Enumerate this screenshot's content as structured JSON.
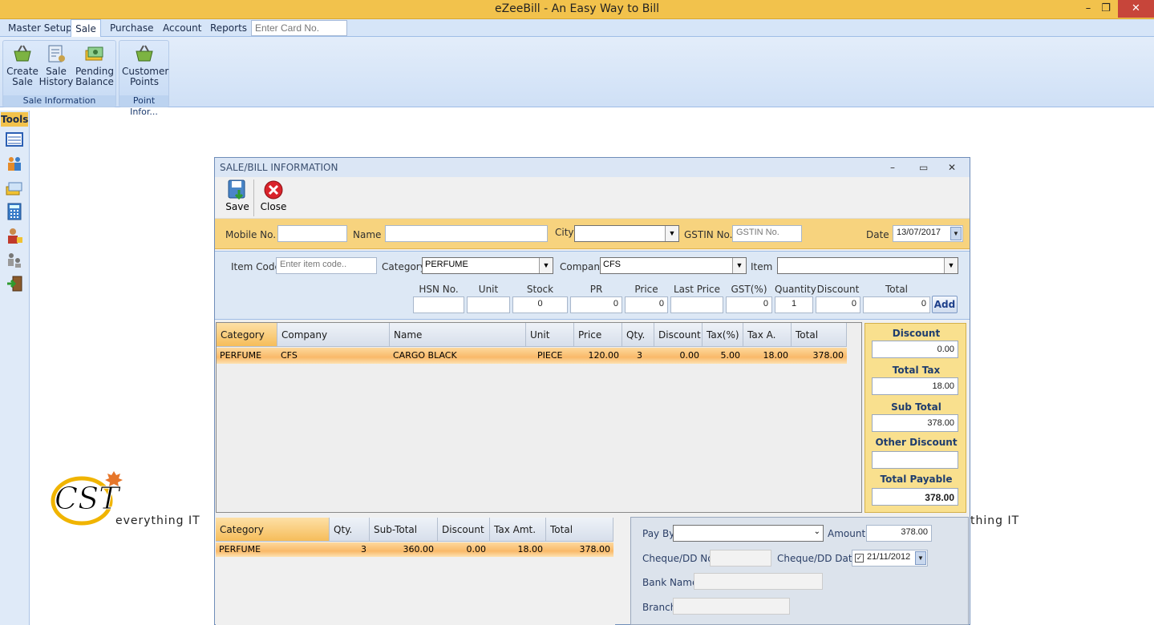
{
  "app": {
    "title": "eZeeBill - An Easy Way to Bill"
  },
  "window_controls": {
    "minimize": "–",
    "restore": "❐",
    "close": "✕"
  },
  "menu": {
    "items": [
      "Master Setup",
      "Sale",
      "Purchase",
      "Account",
      "Reports"
    ],
    "active": "Sale",
    "card_placeholder": "Enter Card No."
  },
  "ribbon": {
    "groups": [
      {
        "caption": "Sale Information",
        "buttons": [
          {
            "label1": "Create",
            "label2": "Sale"
          },
          {
            "label1": "Sale",
            "label2": "History"
          },
          {
            "label1": "Pending",
            "label2": "Balance"
          }
        ]
      },
      {
        "caption": "Point Infor...",
        "buttons": [
          {
            "label1": "Customer",
            "label2": "Points"
          }
        ]
      }
    ]
  },
  "tools": {
    "label": "Tools"
  },
  "logo": {
    "text": "CST",
    "tagline": "everything IT",
    "tagline_right": "thing IT"
  },
  "dialog": {
    "title": "SALE/BILL INFORMATION",
    "controls": {
      "minimize": "–",
      "maximize": "▭",
      "close": "✕"
    },
    "toolbar": {
      "save": "Save",
      "close": "Close"
    },
    "customer": {
      "mobile_label": "Mobile No.",
      "mobile_value": "",
      "name_label": "Name",
      "name_value": "",
      "city_label": "City",
      "city_value": "",
      "gstin_label": "GSTIN No.",
      "gstin_placeholder": "GSTIN No.",
      "date_label": "Date",
      "date_value": "13/07/2017"
    },
    "item": {
      "code_label": "Item Code",
      "code_placeholder": "Enter item code..",
      "category_label": "Category",
      "category_value": "PERFUME",
      "company_label": "Company",
      "company_value": "CFS",
      "item_label": "Item",
      "item_value": "",
      "columns": [
        "HSN No.",
        "Unit",
        "Stock",
        "PR",
        "Price",
        "Last Price",
        "GST(%)",
        "Quantity",
        "Discount",
        "Total"
      ],
      "values": [
        "",
        "",
        "0",
        "0",
        "0",
        "",
        "0",
        "1",
        "0",
        "0"
      ],
      "add_label": "Add"
    },
    "grid": {
      "columns": [
        "Category",
        "Company",
        "Name",
        "Unit",
        "Price",
        "Qty.",
        "Discount",
        "Tax(%)",
        "Tax A.",
        "Total"
      ],
      "rows": [
        [
          "PERFUME",
          "CFS",
          "CARGO BLACK",
          "PIECE",
          "120.00",
          "3",
          "0.00",
          "5.00",
          "18.00",
          "378.00"
        ]
      ]
    },
    "totals": {
      "discount_label": "Discount",
      "discount_value": "0.00",
      "tax_label": "Total Tax",
      "tax_value": "18.00",
      "subtotal_label": "Sub Total",
      "subtotal_value": "378.00",
      "other_discount_label": "Other Discount",
      "other_discount_value": "",
      "payable_label": "Total Payable",
      "payable_value": "378.00"
    },
    "summary": {
      "columns": [
        "Category",
        "Qty.",
        "Sub-Total",
        "Discount",
        "Tax Amt.",
        "Total"
      ],
      "rows": [
        [
          "PERFUME",
          "3",
          "360.00",
          "0.00",
          "18.00",
          "378.00"
        ]
      ]
    },
    "payment": {
      "payby_label": "Pay By",
      "payby_value": "",
      "amount_label": "Amount",
      "amount_value": "378.00",
      "cheque_no_label": "Cheque/DD No.",
      "cheque_no_value": "",
      "cheque_date_label": "Cheque/DD Date",
      "cheque_date_value": "21/11/2012",
      "cheque_date_checked": true,
      "bank_label": "Bank Name",
      "bank_value": "",
      "branch_label": "Branch",
      "branch_value": ""
    }
  },
  "colors": {
    "accent": "#f2c24c",
    "ribbon": "#d6e5f8",
    "selected_row": "#f9b969"
  }
}
